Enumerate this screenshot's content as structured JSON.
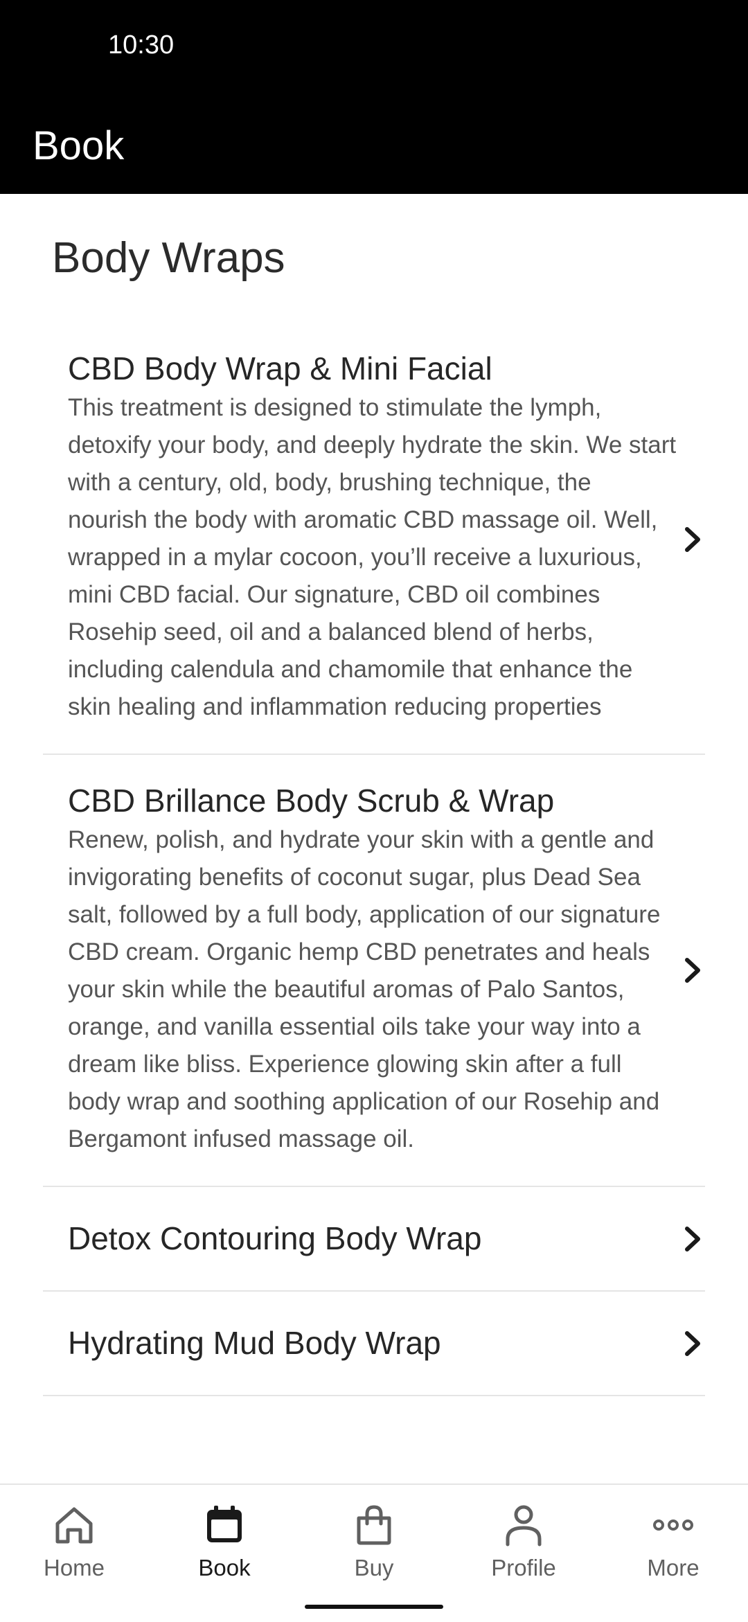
{
  "status_bar": {
    "time": "10:30"
  },
  "app_bar": {
    "title": "Book"
  },
  "section": {
    "title": "Body Wraps"
  },
  "services": [
    {
      "name": "CBD Body Wrap & Mini Facial",
      "description": "This treatment is designed to stimulate the lymph, detoxify your body, and deeply hydrate the skin. We start with a century, old, body, brushing technique, the nourish the body with aromatic CBD massage oil. Well, wrapped in a mylar cocoon, you’ll receive a luxurious, mini CBD facial. Our signature, CBD oil combines Rosehip seed, oil and a balanced blend of herbs, including calendula and chamomile that enhance the skin healing and inflammation reducing properties"
    },
    {
      "name": "CBD Brillance Body Scrub & Wrap",
      "description": "Renew, polish, and hydrate your skin with a gentle and invigorating benefits of coconut sugar, plus Dead Sea salt, followed by a full body, application of our signature CBD cream. Organic hemp CBD penetrates and heals your skin while the beautiful aromas of Palo Santos, orange, and vanilla essential oils take your way into a dream like bliss. Experience glowing skin after a full body wrap and soothing application of our Rosehip and Bergamont infused massage oil."
    },
    {
      "name": "Detox Contouring Body Wrap"
    },
    {
      "name": "Hydrating Mud Body Wrap"
    }
  ],
  "chevron_icon": "chevron-right-icon",
  "bottom_nav": {
    "active": "Book",
    "items": [
      {
        "label": "Home",
        "icon": "home-icon"
      },
      {
        "label": "Book",
        "icon": "calendar-icon"
      },
      {
        "label": "Buy",
        "icon": "shopping-bag-icon"
      },
      {
        "label": "Profile",
        "icon": "person-icon"
      },
      {
        "label": "More",
        "icon": "more-dots-icon"
      }
    ]
  },
  "colors": {
    "header_background": "#000000",
    "header_text": "#ffffff",
    "primary_text": "#262626",
    "secondary_text": "#555555",
    "divider": "#e5e5e5",
    "nav_inactive": "#606060",
    "nav_active": "#1a1a1a"
  }
}
